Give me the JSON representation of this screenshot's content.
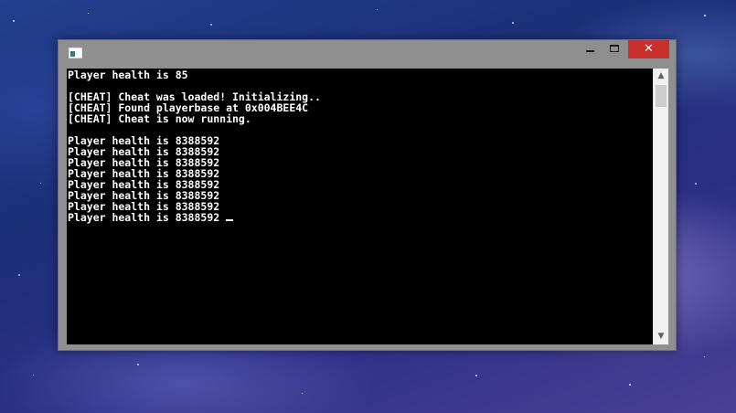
{
  "window": {
    "title": ""
  },
  "titlebar": {
    "minimize_glyph": "",
    "maximize_glyph": "",
    "close_glyph": "✕",
    "icons": {
      "app": "console-app-icon",
      "minimize": "minimize-icon",
      "maximize": "maximize-icon",
      "close": "close-icon"
    }
  },
  "console": {
    "lines": [
      "Player health is 85",
      "",
      "[CHEAT] Cheat was loaded! Initializing..",
      "[CHEAT] Found playerbase at 0x004BEE4C",
      "[CHEAT] Cheat is now running.",
      "",
      "Player health is 8388592",
      "Player health is 8388592",
      "Player health is 8388592",
      "Player health is 8388592",
      "Player health is 8388592",
      "Player health is 8388592",
      "Player health is 8388592",
      "Player health is 8388592 "
    ]
  },
  "scrollbar": {
    "up_glyph": "▲",
    "down_glyph": "▼",
    "icons": {
      "up": "scroll-up-arrow-icon",
      "down": "scroll-down-arrow-icon"
    }
  },
  "colors": {
    "console_background": "#000000",
    "console_text": "#ffffff",
    "window_frame": "#8f8f8f",
    "close_button": "#c7302b",
    "scrollbar_track": "#f0f0f0",
    "scrollbar_thumb": "#cdcdcd"
  }
}
